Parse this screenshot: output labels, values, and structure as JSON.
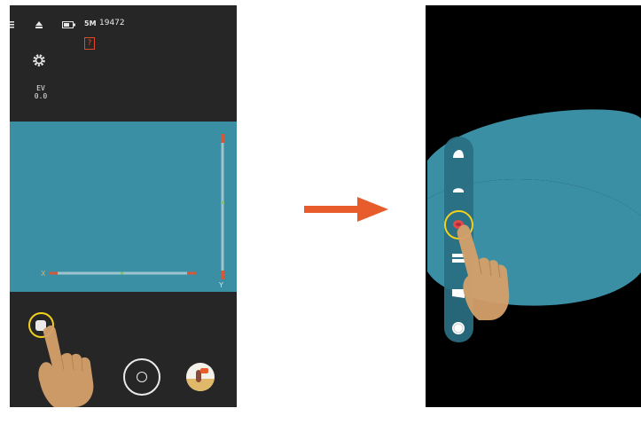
{
  "left_phone": {
    "status": {
      "megapixels": "5M",
      "shots_remaining": "19472",
      "sd_warning": "?"
    },
    "ev": {
      "label": "EV",
      "value": "0.0"
    },
    "icons": {
      "menu": "menu-icon",
      "eject": "eject-icon",
      "battery": "battery-icon",
      "settings": "gear-icon",
      "mode": "camera-mode-icon",
      "shutter": "shutter-button",
      "gallery": "gallery-thumbnail"
    },
    "colors": {
      "background": "#262626",
      "viewfinder": "#3a8fa4",
      "highlight_ring": "#f2d21b",
      "warning": "#e04a2a"
    }
  },
  "arrow": {
    "color": "#e85b2a"
  },
  "right_phone": {
    "mode_menu": {
      "items": [
        "mode-item-1",
        "mode-item-2",
        "mode-item-3",
        "mode-item-4",
        "mode-item-5",
        "mode-item-6"
      ],
      "selected_index": 2
    },
    "colors": {
      "background": "#000000",
      "band": "#3a8fa4",
      "menu_panel": "#2a6f82",
      "selected_item": "#e04a4a"
    }
  },
  "hand": {
    "skin_color": "#d4a06a"
  }
}
